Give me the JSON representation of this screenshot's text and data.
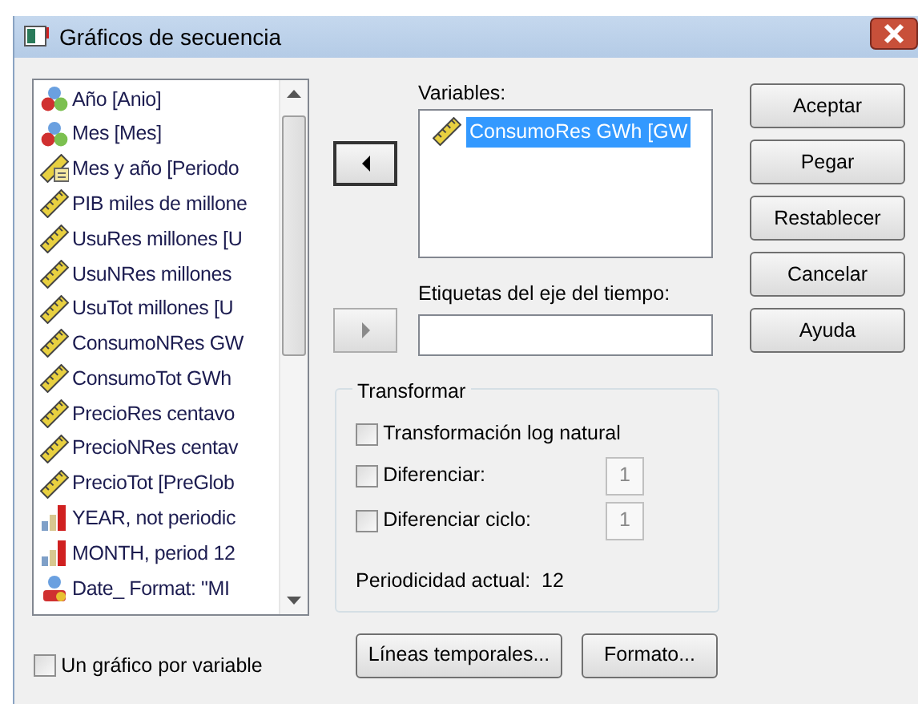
{
  "window": {
    "title": "Gráficos de secuencia"
  },
  "source_list": {
    "items": [
      {
        "label": "Año [Anio]",
        "kind": "nominal"
      },
      {
        "label": "Mes [Mes]",
        "kind": "nominal"
      },
      {
        "label": "Mes y año [Periodo",
        "kind": "date"
      },
      {
        "label": "PIB miles de millone",
        "kind": "scale"
      },
      {
        "label": "UsuRes millones [U",
        "kind": "scale"
      },
      {
        "label": "UsuNRes millones",
        "kind": "scale"
      },
      {
        "label": "UsuTot millones [U",
        "kind": "scale"
      },
      {
        "label": "ConsumoNRes GW",
        "kind": "scale"
      },
      {
        "label": "ConsumoTot GWh",
        "kind": "scale"
      },
      {
        "label": "PrecioRes centavo",
        "kind": "scale"
      },
      {
        "label": "PrecioNRes centav",
        "kind": "scale"
      },
      {
        "label": "PrecioTot [PreGlob",
        "kind": "scale"
      },
      {
        "label": "YEAR, not periodic",
        "kind": "ordinal"
      },
      {
        "label": "MONTH, period 12",
        "kind": "ordinal"
      },
      {
        "label": "Date_ Format: \"MI",
        "kind": "string"
      }
    ]
  },
  "move_buttons": [
    {
      "kind": "left",
      "disabled": false
    },
    {
      "kind": "right",
      "disabled": true
    }
  ],
  "variables": {
    "label": "Variables:",
    "items": [
      {
        "label": "ConsumoRes GWh [GW",
        "kind": "scale",
        "selected": true
      }
    ]
  },
  "time_axis": {
    "label": "Etiquetas del eje del tiempo:"
  },
  "transform": {
    "title": "Transformar",
    "options": [
      {
        "label": "Transformación log natural",
        "checked": false
      },
      {
        "label": "Diferenciar:",
        "checked": false,
        "value": "1"
      },
      {
        "label": "Diferenciar ciclo:",
        "checked": false,
        "value": "1"
      }
    ],
    "periodicity": "Periodicidad actual:  12"
  },
  "one_chart_per_variable": {
    "label": "Un gráfico por variable",
    "checked": false
  },
  "buttons": [
    "Aceptar",
    "Pegar",
    "Restablecer",
    "Cancelar",
    "Ayuda"
  ],
  "bottom_buttons": [
    "Líneas temporales...",
    "Formato..."
  ]
}
